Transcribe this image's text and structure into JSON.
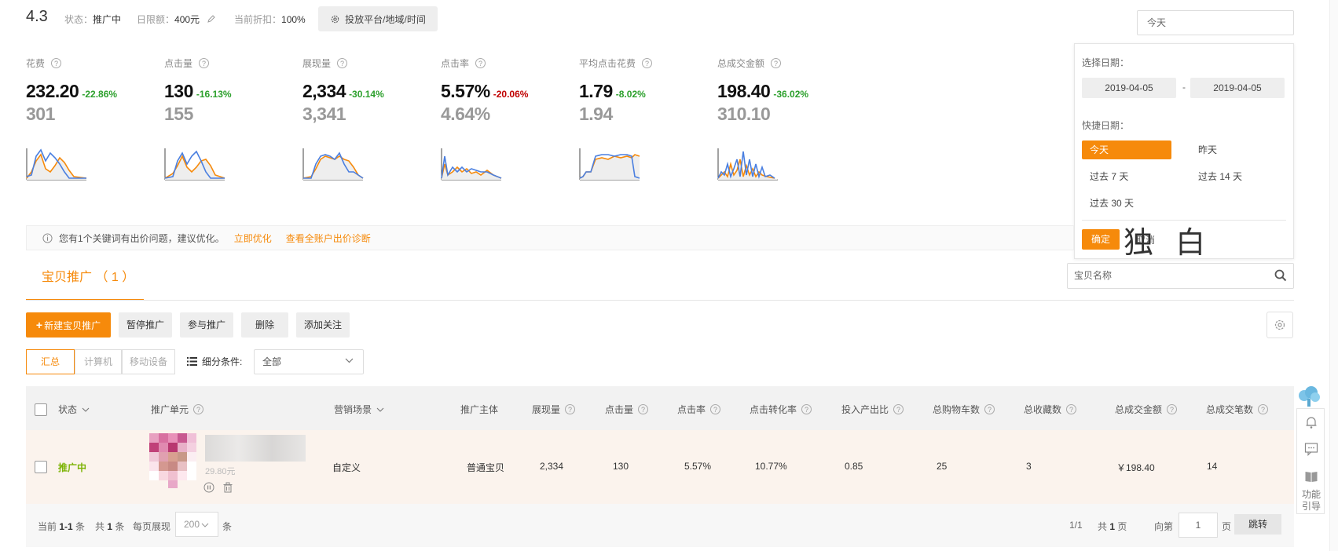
{
  "header": {
    "campaign_name": "4.3",
    "status_label": "状态：",
    "status_value": "推广中",
    "budget_label": "日限额：",
    "budget_value": "400元",
    "discount_label": "当前折扣：",
    "discount_value": "100%",
    "platform_button": "投放平台/地域/时间",
    "date_input": "今天"
  },
  "metrics": [
    {
      "label": "花费",
      "value": "232.20",
      "change": "-22.86%",
      "change_color": "#2ca02c",
      "prev": "301"
    },
    {
      "label": "点击量",
      "value": "130",
      "change": "-16.13%",
      "change_color": "#2ca02c",
      "prev": "155"
    },
    {
      "label": "展现量",
      "value": "2,334",
      "change": "-30.14%",
      "change_color": "#2ca02c",
      "prev": "3,341"
    },
    {
      "label": "点击率",
      "value": "5.57%",
      "change": "-20.06%",
      "change_color": "#c00000",
      "prev": "4.64%"
    },
    {
      "label": "平均点击花费",
      "value": "1.79",
      "change": "-8.02%",
      "change_color": "#2ca02c",
      "prev": "1.94"
    },
    {
      "label": "总成交金额",
      "value": "198.40",
      "change": "-36.02%",
      "change_color": "#2ca02c",
      "prev": "310.10"
    }
  ],
  "date_panel": {
    "select_label": "选择日期：",
    "start_date": "2019-04-05",
    "separator": "-",
    "end_date": "2019-04-05",
    "quick_label": "快捷日期：",
    "options": [
      "今天",
      "昨天",
      "过去 7 天",
      "过去 14 天",
      "过去 30 天"
    ],
    "active_option": "今天",
    "confirm": "确定",
    "cancel": "取消",
    "accent_color": "#f68a0b"
  },
  "watermark": "独 白",
  "notice": {
    "text": "您有1个关键词有出价问题，建议优化。",
    "link1": "立即优化",
    "link2": "查看全账户出价诊断"
  },
  "tab": {
    "label": "宝贝推广 （ 1 ）"
  },
  "search": {
    "placeholder": "宝贝名称"
  },
  "actions": {
    "new": "新建宝贝推广",
    "pause": "暂停推广",
    "join": "参与推广",
    "delete": "删除",
    "follow": "添加关注"
  },
  "view": {
    "summary": "汇总",
    "computer": "计算机",
    "mobile": "移动设备",
    "filter_label": "细分条件:",
    "filter_value": "全部"
  },
  "table": {
    "columns": [
      "状态",
      "推广单元",
      "营销场景",
      "推广主体",
      "展现量",
      "点击量",
      "点击率",
      "点击转化率",
      "投入产出比",
      "总购物车数",
      "总收藏数",
      "总成交金额",
      "总成交笔数"
    ],
    "rows": [
      {
        "status": "推广中",
        "price": "29.80元",
        "scene": "自定义",
        "subject": "普通宝贝",
        "impressions": "2,334",
        "clicks": "130",
        "ctr": "5.57%",
        "cvr": "10.77%",
        "roi": "0.85",
        "carts": "25",
        "favorites": "3",
        "revenue": "￥198.40",
        "orders": "14"
      }
    ]
  },
  "footer": {
    "range_label": "当前",
    "range_value": "1-1",
    "range_unit": "条",
    "total_label": "共",
    "total_value": "1",
    "total_unit": "条",
    "per_page_label": "每页展现",
    "per_page_value": "200",
    "per_page_unit": "条",
    "page_status": "1/1",
    "pages_label": "共",
    "pages_value": "1",
    "pages_unit": "页",
    "goto_label": "向第",
    "goto_value": "1",
    "goto_unit": "页",
    "jump": "跳转"
  },
  "side_toolbar": {
    "guide": "功能引导"
  }
}
